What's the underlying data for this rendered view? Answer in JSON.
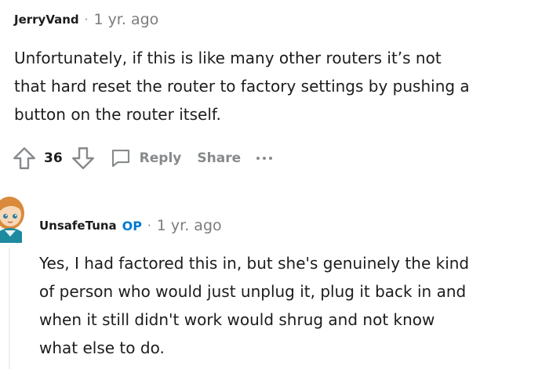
{
  "comments": [
    {
      "username": "JerryVand",
      "separator": "·",
      "time": "1 yr. ago",
      "body_lines": [
        "Unfortunately, if this is like many other routers it’s not",
        "that hard reset the router to factory settings by pushing a",
        "button on the router itself."
      ],
      "score": "36",
      "actions": {
        "reply_label": "Reply",
        "share_label": "Share"
      }
    },
    {
      "username": "UnsafeTuna",
      "op_badge": "OP",
      "separator": "·",
      "time": "1 yr. ago",
      "body_lines": [
        "Yes, I had factored this in, but she's genuinely the kind",
        "of person who would just unplug it, plug it back in and",
        "when it still didn't work would shrug and not know",
        "what else to do."
      ]
    }
  ],
  "icons": {
    "upvote": "arrow-up-icon",
    "downvote": "arrow-down-icon",
    "reply": "comment-bubble-icon",
    "more": "more-dots-icon"
  },
  "colors": {
    "text": "#1c1c1c",
    "muted": "#878a8c",
    "op": "#0079d3",
    "thread_line": "#edeff1"
  }
}
